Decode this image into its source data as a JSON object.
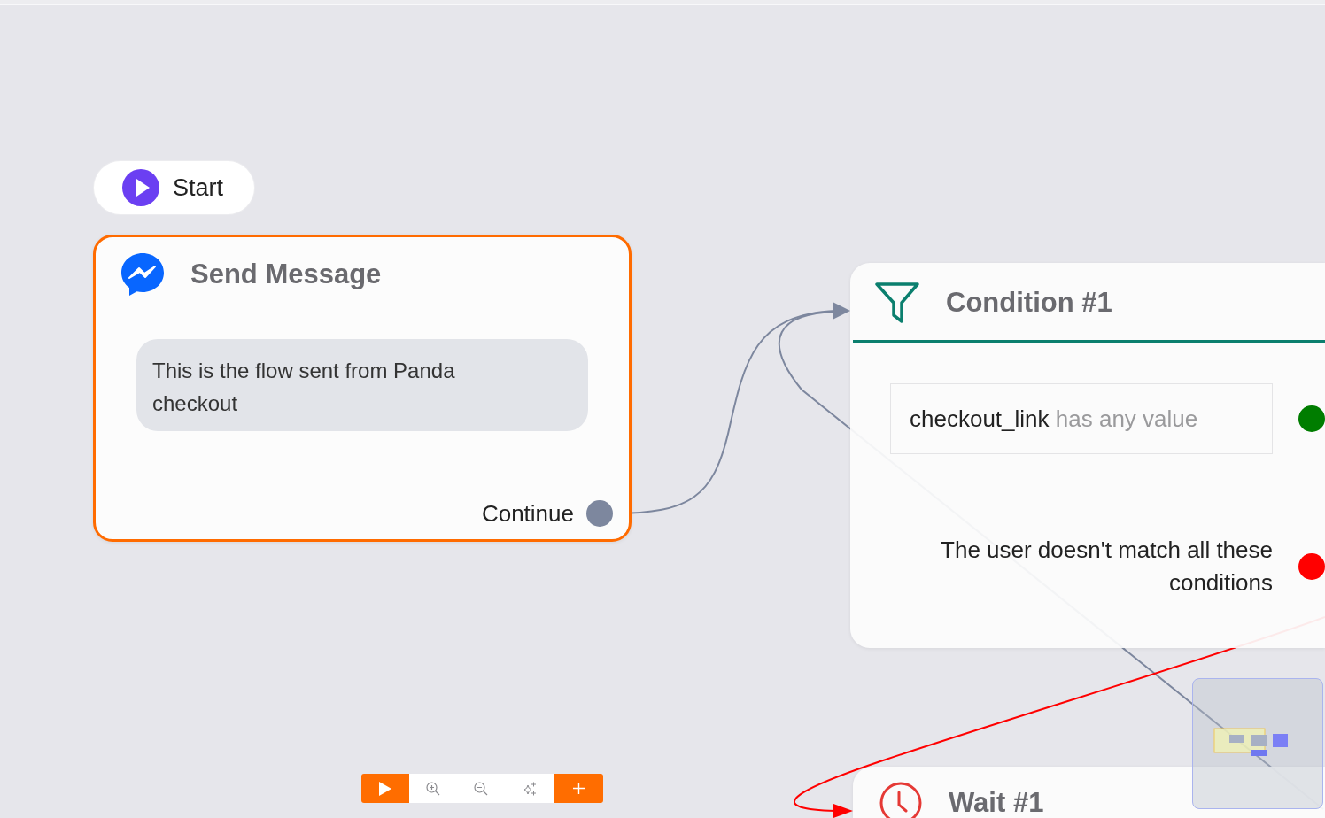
{
  "canvas": {
    "nodes": [
      {
        "kind": "start",
        "label": "Start",
        "selected": false
      },
      {
        "kind": "message",
        "title": "Send Message",
        "selected": true,
        "message": "This is the flow sent from Panda checkout",
        "outputs": [
          {
            "label": "Continue",
            "color": "#7d879e"
          }
        ]
      },
      {
        "kind": "condition",
        "title": "Condition #1",
        "selected": false,
        "outputs": [
          {
            "kind": "match",
            "rule": {
              "field": "checkout_link",
              "operator": "has any value"
            },
            "color": "#007d00"
          },
          {
            "kind": "fallback",
            "label": "The user doesn't match all these conditions",
            "color": "#ff0000"
          }
        ]
      },
      {
        "kind": "wait",
        "title": "Wait #1",
        "selected": false
      }
    ]
  },
  "toolbar": [
    {
      "kind": "run"
    },
    {
      "kind": "zoom_in"
    },
    {
      "kind": "zoom_out"
    },
    {
      "kind": "auto_arrange"
    },
    {
      "kind": "add"
    }
  ]
}
